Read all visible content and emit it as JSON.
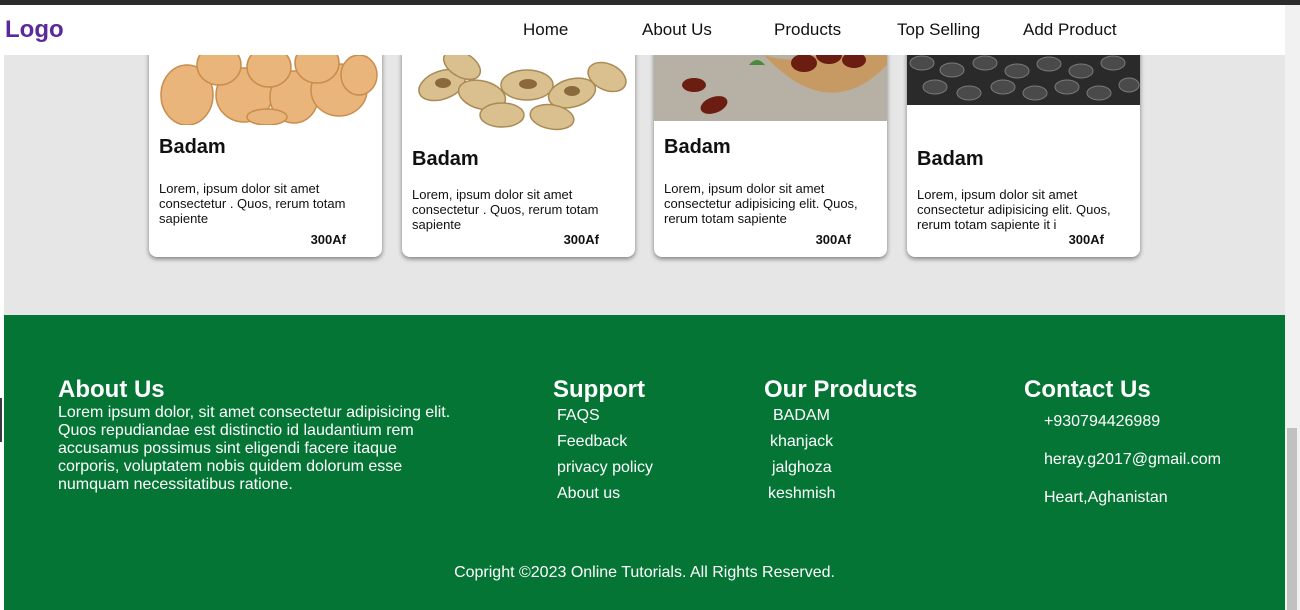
{
  "nav": {
    "logo": "Logo",
    "links": [
      "Home",
      "About Us",
      "Products",
      "Top Selling",
      "Add Product"
    ]
  },
  "products": [
    {
      "title": "Badam",
      "desc": "Lorem, ipsum dolor sit amet consectetur . Quos, rerum totam sapiente",
      "price": "300Af",
      "image": "almonds-image"
    },
    {
      "title": "Badam",
      "desc": "Lorem, ipsum dolor sit amet consectetur . Quos, rerum totam sapiente",
      "price": "300Af",
      "image": "pistachios-image"
    },
    {
      "title": "Badam",
      "desc": "Lorem, ipsum dolor sit amet consectetur adipisicing elit. Quos, rerum totam sapiente",
      "price": "300Af",
      "image": "dates-image"
    },
    {
      "title": "Badam",
      "desc": "Lorem, ipsum dolor sit amet consectetur adipisicing elit. Quos, rerum totam sapiente it i",
      "price": "300Af",
      "image": "seeds-image"
    }
  ],
  "footer": {
    "about": {
      "heading": "About Us",
      "text": "Lorem ipsum dolor, sit amet consectetur adipisicing elit. Quos repudiandae est distinctio id laudantium rem accusamus possimus sint eligendi facere itaque corporis, voluptatem nobis quidem dolorum esse numquam necessitatibus ratione."
    },
    "support": {
      "heading": "Support",
      "links": [
        "FAQS",
        "Feedback",
        "privacy policy",
        "About us"
      ]
    },
    "products": {
      "heading": "Our Products",
      "links": [
        "BADAM",
        "khanjack",
        "jalghoza",
        "keshmish"
      ]
    },
    "contact": {
      "heading": "Contact Us",
      "phone": "+930794426989",
      "email": "heray.g2017@gmail.com",
      "address": "Heart,Aghanistan"
    },
    "copyright": "Copright ©2023 Online Tutorials. All Rights Reserved."
  },
  "colors": {
    "footer_bg": "#057535",
    "logo": "#5b2a9a",
    "page_bg": "#e6e6e6"
  }
}
